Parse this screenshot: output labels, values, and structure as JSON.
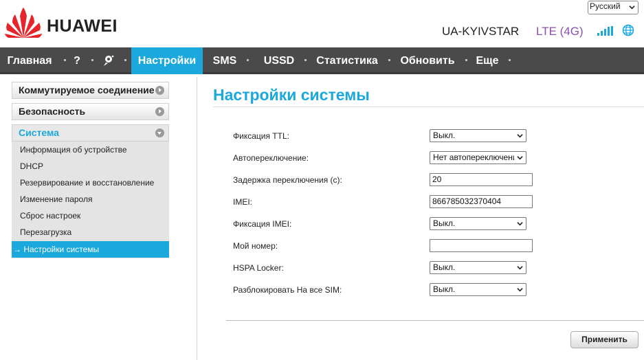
{
  "header": {
    "brand": "HUAWEI",
    "language": "Русский",
    "operator": "UA-KYIVSTAR",
    "network_type": "LTE (4G)",
    "signal_icon": "signal-bars-icon",
    "globe_icon": "globe-icon",
    "accent_color": "#1ba8dc"
  },
  "nav": {
    "home": "Главная",
    "help": "?",
    "settings": "Настройки",
    "sms": "SMS",
    "ussd": "USSD",
    "statistics": "Статистика",
    "update": "Обновить",
    "more": "Еще"
  },
  "sidebar": {
    "dialup": "Коммутируемое соединение",
    "security": "Безопасность",
    "system": "Система",
    "items": [
      "Информация об устройстве",
      "DHCP",
      "Резервирование и восстановление",
      "Изменение пароля",
      "Сброс настроек",
      "Перезагрузка",
      "→ Настройки системы"
    ]
  },
  "main": {
    "title": "Настройки системы",
    "ttl_label": "Фиксация TTL:",
    "ttl_value": "Выкл.",
    "autoswitch_label": "Автопереключение:",
    "autoswitch_value": "Нет автопереключения",
    "delay_label": "Задержка переключения (с):",
    "delay_value": "20",
    "imei_label": "IMEI:",
    "imei_value": "866785032370404",
    "imei_fix_label": "Фиксация IMEI:",
    "imei_fix_value": "Выкл.",
    "my_number_label": "Мой номер:",
    "my_number_value": "",
    "hspa_label": "HSPA Locker:",
    "hspa_value": "Выкл.",
    "unlock_label": "Разблокировать На все SIM:",
    "unlock_value": "Выкл.",
    "apply_label": "Применить"
  }
}
